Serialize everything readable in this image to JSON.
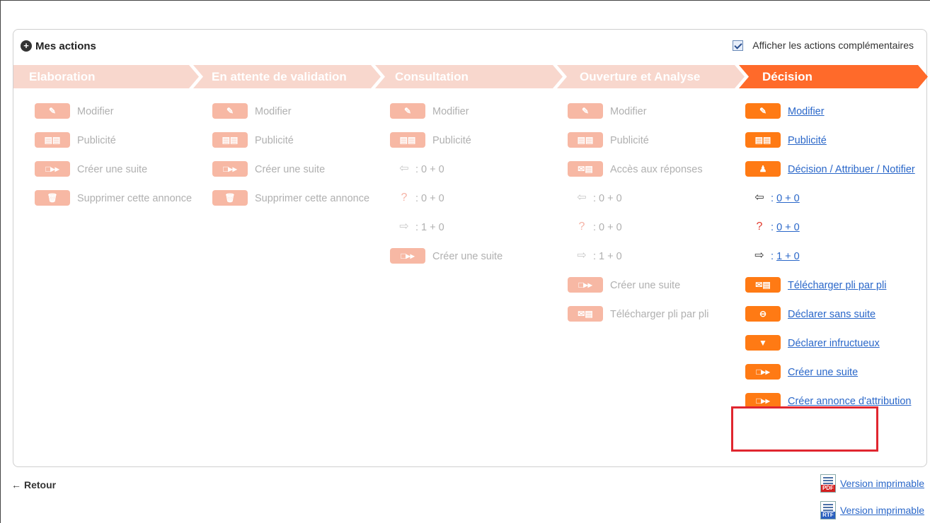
{
  "panel": {
    "title": "Mes actions",
    "toggle_label": "Afficher les actions complémentaires",
    "toggle_checked": true
  },
  "steps": [
    {
      "label": "Elaboration",
      "active": false
    },
    {
      "label": "En attente de validation",
      "active": false
    },
    {
      "label": "Consultation",
      "active": false
    },
    {
      "label": "Ouverture et Analyse",
      "active": false
    },
    {
      "label": "Décision",
      "active": true
    }
  ],
  "columns": {
    "elaboration": {
      "modifier": "Modifier",
      "publicite": "Publicité",
      "creer_suite": "Créer une suite",
      "supprimer": "Supprimer cette annonce"
    },
    "attente": {
      "modifier": "Modifier",
      "publicite": "Publicité",
      "creer_suite": "Créer une suite",
      "supprimer": "Supprimer cette annonce"
    },
    "consultation": {
      "modifier": "Modifier",
      "publicite": "Publicité",
      "count1": ": 0 + 0",
      "count2": ": 0 + 0",
      "count3": ": 1 + 0",
      "creer_suite": "Créer une suite"
    },
    "ouverture": {
      "modifier": "Modifier",
      "publicite": "Publicité",
      "acces": "Accès aux réponses",
      "count1": ": 0 + 0",
      "count2": ": 0 + 0",
      "count3": ": 1 + 0",
      "creer_suite": "Créer une suite",
      "telecharger": "Télécharger pli par pli"
    },
    "decision": {
      "modifier": "Modifier",
      "publicite": "Publicité",
      "decision": "Décision / Attribuer / Notifier",
      "count1": "0 + 0",
      "count2": "0 + 0",
      "count3": "1 + 0",
      "telecharger": "Télécharger pli par pli",
      "sans_suite": "Déclarer sans suite",
      "infructueux": "Déclarer infructueux",
      "creer_suite": "Créer une suite",
      "creer_annonce": "Créer annonce d'attribution"
    }
  },
  "footer": {
    "back_label": "Retour",
    "print_pdf": "Version imprimable",
    "print_rtf": "Version imprimable",
    "pdf_tag": "PDF",
    "rtf_tag": "RTF"
  },
  "colors": {
    "active_step": "#ff6a2a",
    "pale_step": "#f8d7cd",
    "badge_active": "#ff7a14",
    "badge_pale": "#f7b8a4",
    "highlight": "#e0262f"
  }
}
